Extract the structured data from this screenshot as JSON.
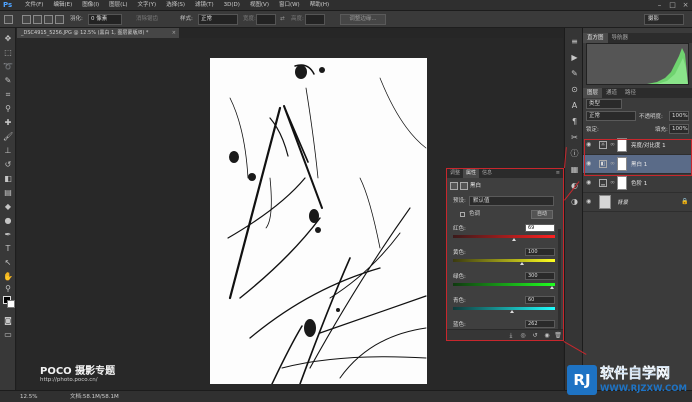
{
  "app": {
    "logo": "Ps"
  },
  "menu": [
    "文件(F)",
    "编辑(E)",
    "图像(I)",
    "图层(L)",
    "文字(Y)",
    "选择(S)",
    "滤镜(T)",
    "3D(D)",
    "视图(V)",
    "窗口(W)",
    "帮助(H)"
  ],
  "options": {
    "feather_label": "羽化:",
    "feather_value": "0 像素",
    "antialias_label": "消除锯齿",
    "style_label": "样式:",
    "style_value": "正常",
    "width_label": "宽度:",
    "height_label": "高度:",
    "refine_button": "调整边缘...",
    "workspace": "摄影"
  },
  "document": {
    "tab_title": "_DSC4915_5256.JPG @ 12.5% (黑白 1, 图层蒙版/8) *",
    "zoom": "12.5%",
    "doc_info": "文档:58.1M/58.1M"
  },
  "panels": {
    "top_tabs": [
      "直方图",
      "导航器"
    ],
    "layer_tabs": [
      "图层",
      "通道",
      "路径"
    ],
    "kind_label": "类型",
    "blend_mode": "正常",
    "opacity_label": "不透明度:",
    "opacity_value": "100%",
    "lock_label": "锁定:",
    "fill_label": "填充:",
    "fill_value": "100%",
    "layers": [
      {
        "name": "亮度/对比度 1",
        "selected": false
      },
      {
        "name": "黑白 1",
        "selected": true
      },
      {
        "name": "色阶 1",
        "selected": false
      },
      {
        "name": "背景",
        "selected": false
      }
    ]
  },
  "properties": {
    "tabs": [
      "调整",
      "属性",
      "信息"
    ],
    "title": "黑白",
    "preset_label": "预设:",
    "preset_value": "默认值",
    "tint_label": "色调",
    "auto_button": "自动",
    "sliders": [
      {
        "label": "红色:",
        "value": "69",
        "pos": 0.6,
        "gradient": "linear-gradient(90deg,#3a1a1a,#ff2020)"
      },
      {
        "label": "黄色:",
        "value": "100",
        "pos": 0.68,
        "gradient": "linear-gradient(90deg,#3a3a10,#ffff20)"
      },
      {
        "label": "绿色:",
        "value": "300",
        "pos": 0.97,
        "gradient": "linear-gradient(90deg,#103a10,#20ff20)"
      },
      {
        "label": "青色:",
        "value": "60",
        "pos": 0.58,
        "gradient": "linear-gradient(90deg,#103a3a,#20ffff)"
      },
      {
        "label": "蓝色:",
        "value": "262",
        "pos": 0.92,
        "gradient": "linear-gradient(90deg,#10103a,#2040ff)"
      }
    ]
  },
  "watermarks": {
    "poco_title": "POCO 摄影专题",
    "poco_url": "http://photo.poco.cn/",
    "logo_mark": "RJ",
    "logo_title": "软件自学网",
    "logo_url": "WWW.RJZXW.COM"
  }
}
